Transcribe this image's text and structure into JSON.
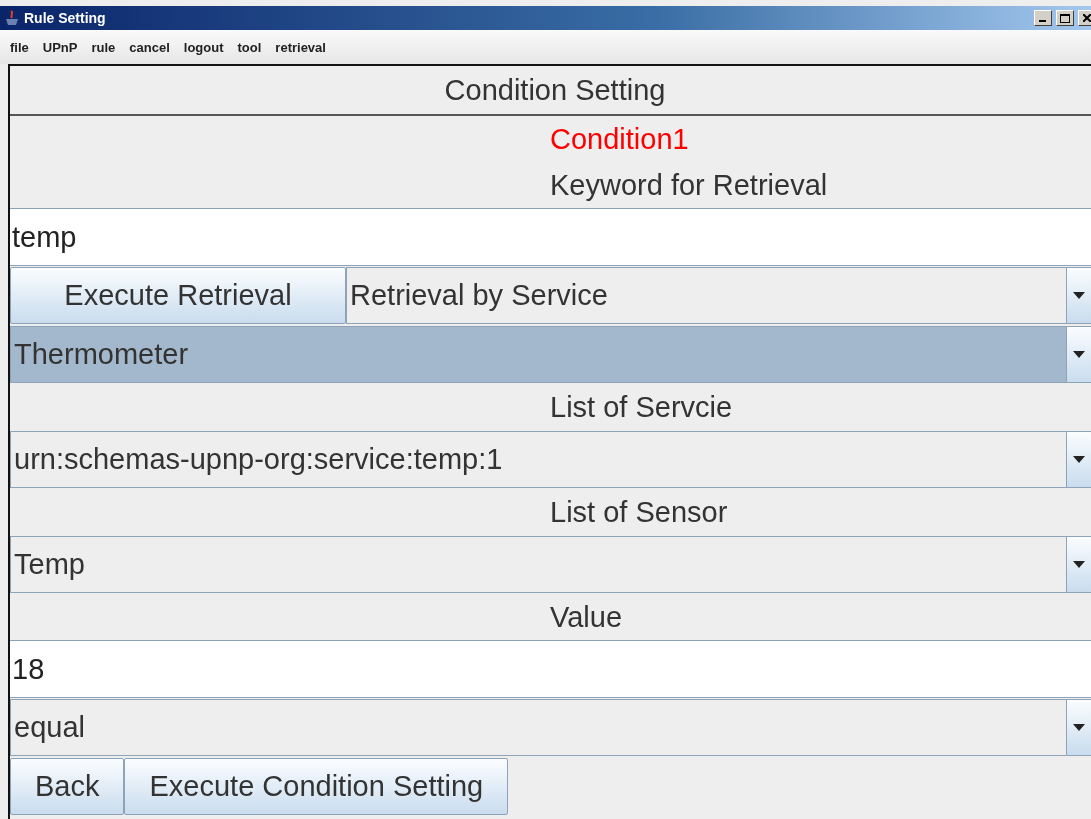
{
  "window": {
    "title": "Rule Setting"
  },
  "menu": [
    "file",
    "UPnP",
    "rule",
    "cancel",
    "logout",
    "tool",
    "retrieval"
  ],
  "header": "Condition Setting",
  "rows": [
    {
      "kind": "label",
      "text": "Condition1",
      "color": "#ff0000"
    },
    {
      "kind": "label",
      "text": "Keyword for Retrieval",
      "color": "#333333"
    },
    {
      "kind": "field",
      "value": "temp"
    },
    {
      "kind": "button-combo",
      "button": "Execute Retrieval",
      "value": "Retrieval by Service",
      "highlighted": false
    },
    {
      "kind": "combo",
      "value": "Thermometer",
      "highlighted": true
    },
    {
      "kind": "label",
      "text": "List of Servcie",
      "color": "#333333"
    },
    {
      "kind": "combo",
      "value": "urn:schemas-upnp-org:service:temp:1",
      "highlighted": false
    },
    {
      "kind": "label",
      "text": "List of Sensor",
      "color": "#333333"
    },
    {
      "kind": "combo",
      "value": "Temp",
      "highlighted": false
    },
    {
      "kind": "label",
      "text": "Value",
      "color": "#333333"
    },
    {
      "kind": "field",
      "value": "18"
    },
    {
      "kind": "combo",
      "value": "equal",
      "highlighted": false
    }
  ],
  "buttons": [
    "Back",
    "Execute Condition Setting"
  ]
}
